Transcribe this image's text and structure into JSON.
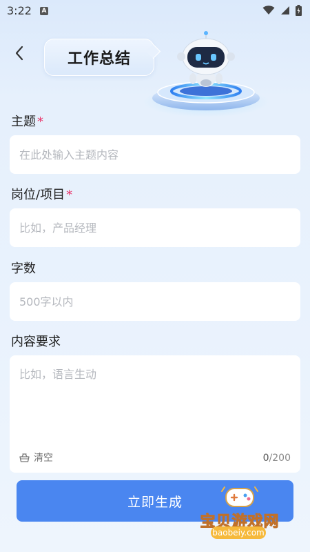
{
  "status_bar": {
    "time": "3:22",
    "notification_icon_letter": "A"
  },
  "header": {
    "title": "工作总结"
  },
  "form": {
    "topic": {
      "label": "主题",
      "required_mark": "*",
      "placeholder": "在此处输入主题内容"
    },
    "position": {
      "label": "岗位/项目",
      "required_mark": "*",
      "placeholder": "比如，产品经理"
    },
    "word_count": {
      "label": "字数",
      "placeholder": "500字以内"
    },
    "requirements": {
      "label": "内容要求",
      "placeholder": "比如，语言生动",
      "clear_label": "清空",
      "count_current": "0",
      "count_max": "/200"
    }
  },
  "generate_button": {
    "label": "立即生成"
  },
  "watermark": {
    "text": "宝贝游戏网",
    "sub": "baobeiy.com"
  },
  "colors": {
    "accent": "#4a86f0",
    "required": "#e8356a",
    "background": "#e6f0fc"
  }
}
